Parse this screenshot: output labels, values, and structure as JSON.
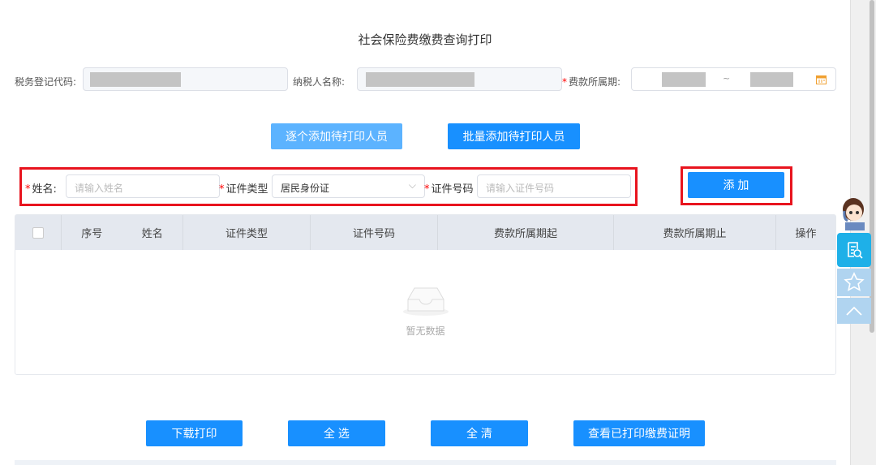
{
  "page_title": "社会保险费缴费查询打印",
  "filters": {
    "tax_code_label": "税务登记代码:",
    "taxpayer_name_label": "纳税人名称:",
    "period_label": "费款所属期:",
    "period_separator": "~"
  },
  "buttons": {
    "add_single": "逐个添加待打印人员",
    "add_batch": "批量添加待打印人员",
    "add": "添 加",
    "download_print": "下载打印",
    "select_all": "全 选",
    "clear_all": "全 清",
    "view_printed": "查看已打印缴费证明"
  },
  "form": {
    "name_label": "姓名:",
    "name_placeholder": "请输入姓名",
    "id_type_label": "证件类型",
    "id_type_value": "居民身份证",
    "id_number_label": "证件号码",
    "id_number_placeholder": "请输入证件号码"
  },
  "table": {
    "columns": [
      "序号",
      "姓名",
      "证件类型",
      "证件号码",
      "费款所属期起",
      "费款所属期止",
      "操作"
    ],
    "empty_text": "暂无数据"
  },
  "colors": {
    "primary": "#1890ff",
    "highlight": "#e8141e",
    "side_blue": "#1eb0e8"
  }
}
